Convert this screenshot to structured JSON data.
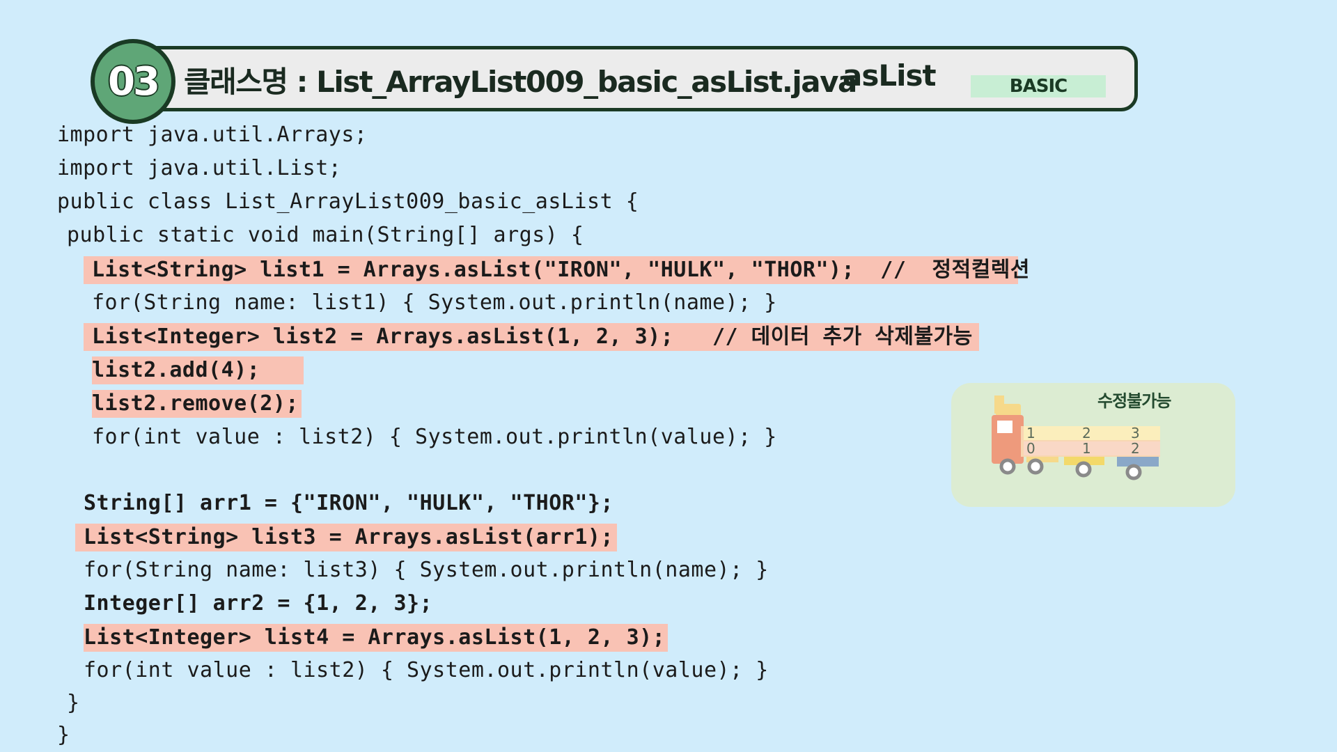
{
  "header": {
    "number": "03",
    "title": "클래스명 : List_ArrayList009_basic_asList.java",
    "subtitle": "asList",
    "level": "BASIC"
  },
  "code_lines": [
    "import java.util.Arrays;",
    "import java.util.List;",
    "public class List_ArrayList009_basic_asList {",
    "public static void main(String[] args) {",
    "List<String> list1 = Arrays.asList(\"IRON\", \"HULK\", \"THOR\");  //  정적컬렉션",
    "for(String name: list1) { System.out.println(name); }",
    "List<Integer> list2 = Arrays.asList(1, 2, 3);   // 데이터 추가 삭제불가능",
    "list2.add(4);",
    "list2.remove(2);",
    "for(int value : list2) { System.out.println(value); }",
    "String[] arr1 = {\"IRON\", \"HULK\", \"THOR\"};",
    "List<String> list3 = Arrays.asList(arr1);",
    "for(String name: list3) { System.out.println(name); }",
    "Integer[] arr2 = {1, 2, 3};",
    "List<Integer> list4 = Arrays.asList(1, 2, 3);",
    "for(int value : list2) { System.out.println(value); }",
    "}",
    "}"
  ],
  "illustration": {
    "label": "수정불가능",
    "values": [
      "1",
      "2",
      "3"
    ],
    "indexes": [
      "0",
      "1",
      "2"
    ]
  },
  "colors": {
    "background": "#d0ecfb",
    "highlight": "#f9c2b4",
    "header_border": "#1a3a24",
    "badge": "#5fa677",
    "level_badge": "#c8eed4",
    "card": "#dcecd2"
  }
}
